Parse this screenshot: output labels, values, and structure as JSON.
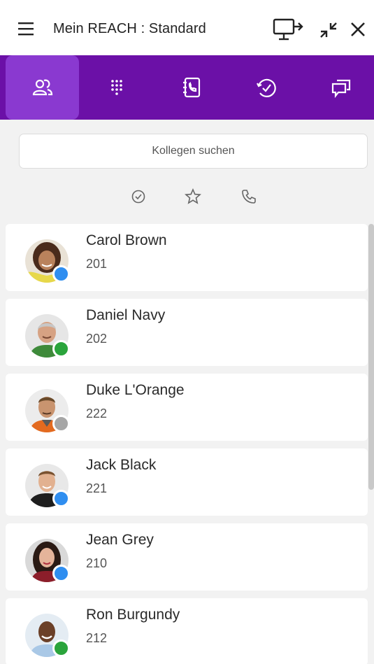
{
  "header": {
    "title": "Mein REACH : Standard",
    "icons": [
      "hamburger-menu-icon",
      "screen-share-icon",
      "shrink-icon",
      "close-icon"
    ]
  },
  "tabs": [
    {
      "icon": "contacts-icon",
      "active": true
    },
    {
      "icon": "dialpad-icon",
      "active": false
    },
    {
      "icon": "phonebook-icon",
      "active": false
    },
    {
      "icon": "call-history-icon",
      "active": false
    },
    {
      "icon": "chat-icon",
      "active": false
    }
  ],
  "search": {
    "placeholder": "Kollegen suchen"
  },
  "filters": [
    "available-filter-icon",
    "favorite-filter-icon",
    "phone-filter-icon"
  ],
  "colors": {
    "brand": "#6b10a7",
    "brand_active": "#8a39d0",
    "status_blue": "#2f8ef0",
    "status_green": "#2aa43b",
    "status_gray": "#a6a6a6"
  },
  "contacts": [
    {
      "name": "Carol Brown",
      "ext": "201",
      "status": "blue"
    },
    {
      "name": "Daniel Navy",
      "ext": "202",
      "status": "green"
    },
    {
      "name": "Duke L'Orange",
      "ext": "222",
      "status": "gray"
    },
    {
      "name": "Jack Black",
      "ext": "221",
      "status": "blue"
    },
    {
      "name": "Jean Grey",
      "ext": "210",
      "status": "blue"
    },
    {
      "name": "Ron Burgundy",
      "ext": "212",
      "status": "green"
    }
  ]
}
